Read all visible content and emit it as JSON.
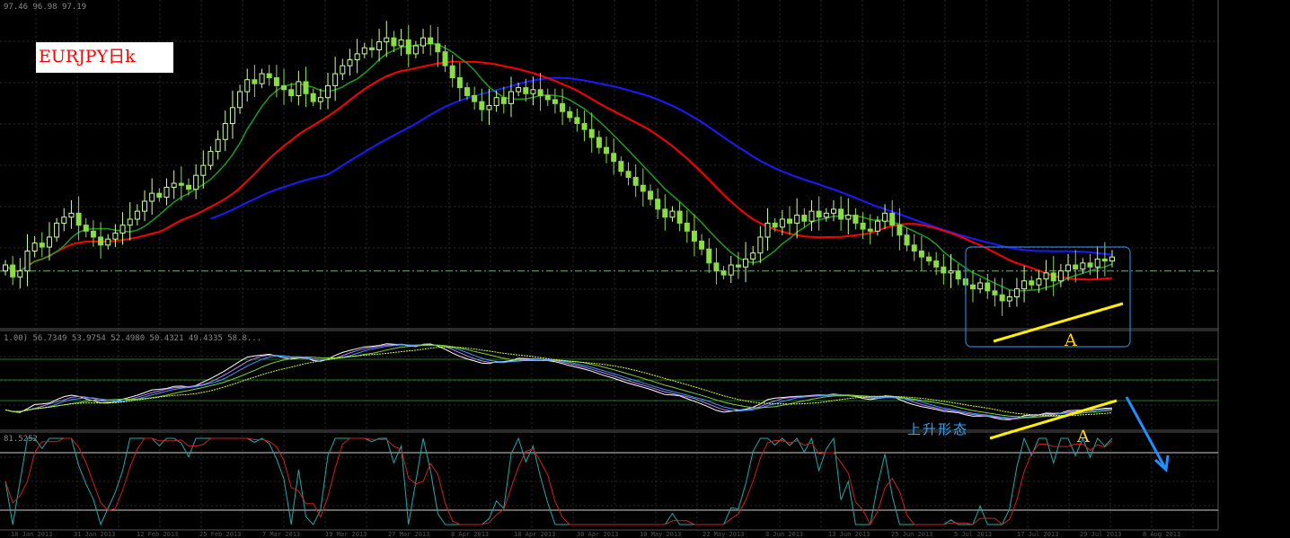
{
  "header": {
    "price_readout": "97.46 96.98 97.19",
    "osc1_readout": "1.00) 56.7349 53.9754 52.4980 50.4321 49.4335 58.8...",
    "osc2_readout": "81.5252"
  },
  "annotations": {
    "title": "EURJPY日k",
    "label_a_top": "A",
    "label_a_bottom": "A",
    "label_rising": "上升形态"
  },
  "x_axis_labels": [
    "18 Jan 2013",
    "31 Jan 2013",
    "12 Feb 2013",
    "25 Feb 2013",
    "7 Mar 2013",
    "19 Mar 2013",
    "27 Mar 2013",
    "8 Apr 2013",
    "18 Apr 2013",
    "30 Apr 2013",
    "10 May 2013",
    "22 May 2013",
    "3 Jun 2013",
    "13 Jun 2013",
    "25 Jun 2013",
    "5 Jul 2013",
    "17 Jul 2013",
    "29 Jul 2013",
    "8 Aug 2013"
  ],
  "colors": {
    "background": "#000000",
    "grid": "#2a2a2a",
    "bull_candle": "#ccff99",
    "bear_candle": "#8bdd44",
    "ma_fast": "#1e9e1e",
    "ma_red": "#ff0000",
    "ma_blue": "#1a1aff",
    "ma_yellow": "#ffff00",
    "dashed_level": "#22cc22",
    "trend_line": "#ffee00",
    "box": "#2a7fd4",
    "arrow": "#1e90ff",
    "stoch_main": "#d02020",
    "stoch_signal": "#22aaaa"
  },
  "chart_data": {
    "type": "candlestick",
    "symbol": "EURJPY",
    "timeframe": "daily",
    "title": "EURJPY日k",
    "price_close": [
      120.2,
      119.6,
      119.9,
      120.9,
      121.3,
      121.1,
      121.6,
      122.3,
      122.6,
      122.8,
      122.2,
      121.9,
      121.6,
      121.2,
      121.5,
      121.8,
      122.2,
      122.5,
      122.9,
      123.4,
      123.8,
      123.6,
      124.1,
      124.3,
      124.2,
      124.0,
      124.7,
      125.2,
      125.9,
      126.5,
      127.3,
      128.1,
      128.9,
      129.5,
      129.3,
      129.8,
      129.6,
      129.2,
      129.0,
      128.7,
      129.4,
      128.8,
      128.4,
      128.6,
      129.2,
      129.8,
      130.2,
      130.5,
      130.8,
      131.1,
      131.0,
      131.4,
      131.6,
      131.2,
      131.5,
      130.8,
      131.2,
      131.6,
      131.3,
      130.9,
      130.2,
      129.6,
      129.1,
      128.7,
      128.4,
      128.0,
      128.2,
      128.6,
      128.3,
      128.9,
      129.1,
      128.8,
      129.0,
      128.7,
      128.5,
      128.3,
      127.9,
      127.6,
      127.3,
      127.0,
      126.6,
      126.1,
      125.8,
      125.4,
      124.9,
      124.6,
      124.2,
      123.9,
      123.5,
      123.0,
      122.6,
      122.9,
      122.3,
      121.9,
      121.4,
      121.0,
      120.3,
      119.9,
      119.7,
      120.2,
      120.1,
      120.5,
      120.8,
      121.6,
      122.3,
      122.1,
      122.5,
      122.3,
      122.7,
      122.4,
      122.9,
      122.6,
      122.8,
      123.0,
      122.5,
      122.7,
      122.3,
      122.0,
      121.9,
      122.4,
      122.8,
      122.2,
      121.7,
      121.2,
      120.9,
      120.6,
      120.4,
      120.1,
      119.8,
      119.9,
      119.5,
      119.2,
      119.0,
      119.3,
      118.9,
      118.7,
      118.4,
      118.6,
      119.0,
      119.4,
      119.2,
      119.5,
      119.8,
      119.4,
      119.9,
      120.2,
      120.0,
      120.3,
      120.1,
      120.5,
      120.4,
      120.6
    ],
    "dashed_level": 119.9,
    "oscillator_1_range": [
      0,
      100
    ],
    "oscillator_2_range": [
      0,
      100
    ]
  }
}
